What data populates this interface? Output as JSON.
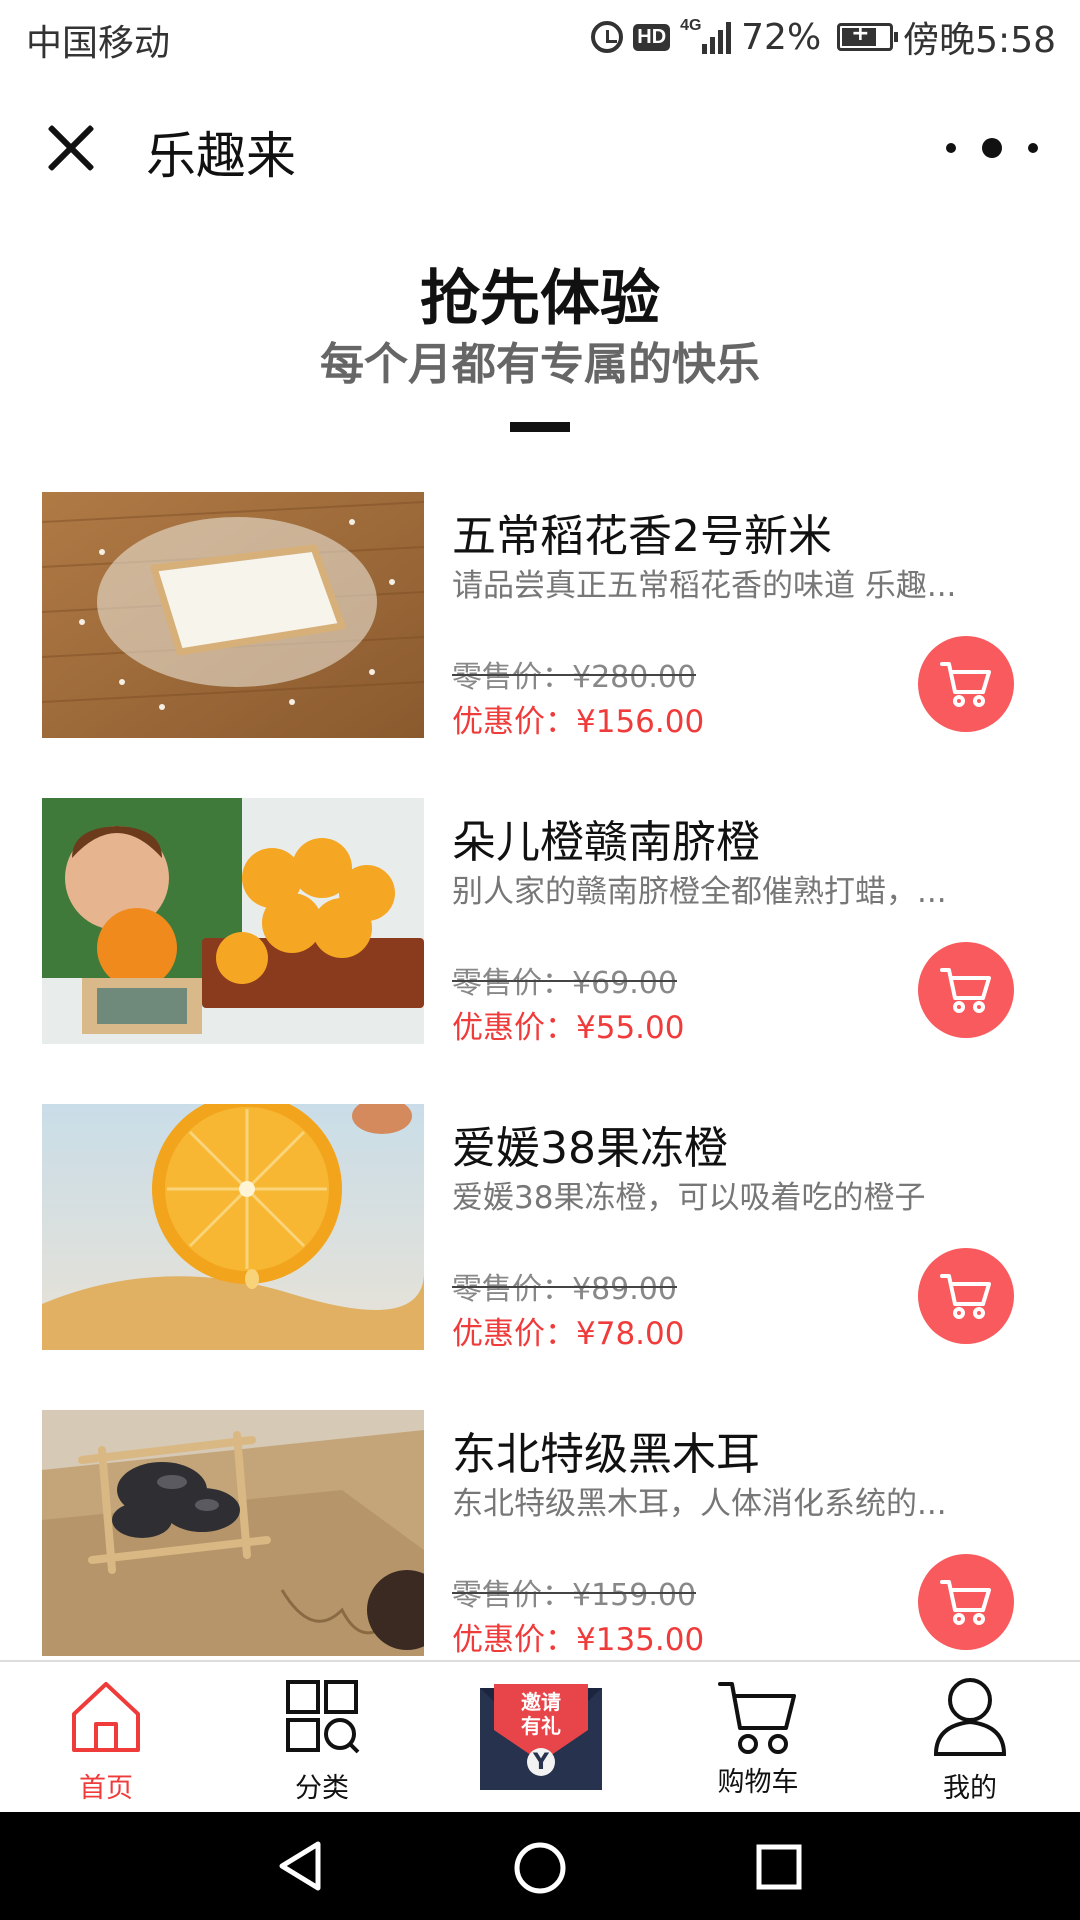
{
  "status_bar": {
    "carrier": "中国移动",
    "hd_label": "HD",
    "network": "4G",
    "battery_percent": "72%",
    "time": "傍晚5:58"
  },
  "nav": {
    "title": "乐趣来",
    "close_icon": "close-icon",
    "more_icon": "more-dots-icon"
  },
  "header": {
    "title": "抢先体验",
    "subtitle": "每个月都有专属的快乐"
  },
  "products": [
    {
      "name": "五常稻花香2号新米",
      "description": "请品尝真正五常稻花香的味道 乐趣...",
      "retail_price": "零售价：¥280.00",
      "sale_price": "优惠价：¥156.00"
    },
    {
      "name": "朵儿橙赣南脐橙",
      "description": "别人家的赣南脐橙全都催熟打蜡，...",
      "retail_price": "零售价：¥69.00",
      "sale_price": "优惠价：¥55.00"
    },
    {
      "name": "爱媛38果冻橙",
      "description": "爱媛38果冻橙，可以吸着吃的橙子",
      "retail_price": "零售价：¥89.00",
      "sale_price": "优惠价：¥78.00"
    },
    {
      "name": "东北特级黑木耳",
      "description": "东北特级黑木耳，人体消化系统的...",
      "retail_price": "零售价：¥159.00",
      "sale_price": "优惠价：¥135.00"
    }
  ],
  "tabs": {
    "home": "首页",
    "category": "分类",
    "invite_line1": "邀请",
    "invite_line2": "有礼",
    "invite_symbol": "Y",
    "cart": "购物车",
    "mine": "我的"
  },
  "colors": {
    "accent": "#f03b3b",
    "cart_button": "#f85a5d",
    "invite_envelope": "#27324e"
  }
}
